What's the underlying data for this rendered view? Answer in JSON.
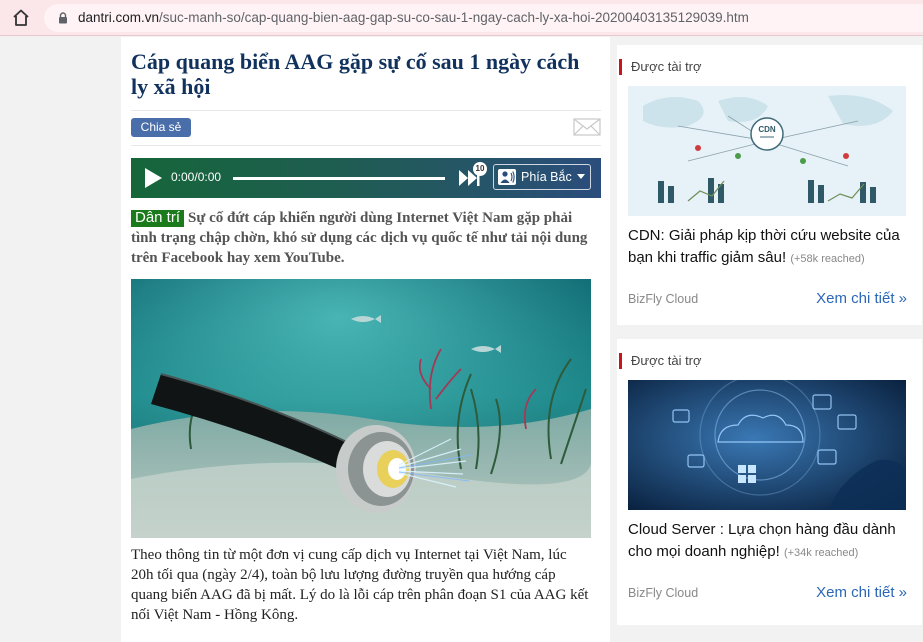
{
  "browser": {
    "url_host": "dantri.com.vn",
    "url_path": "/suc-manh-so/cap-quang-bien-aag-gap-su-co-sau-1-ngay-cach-ly-xa-hoi-20200403135129039.htm"
  },
  "article": {
    "title": "Cáp quang biển AAG gặp sự cố sau 1 ngày cách ly xã hội",
    "share_label": "Chia sẻ",
    "player": {
      "time": "0:00/0:00",
      "skip_seconds": "10",
      "voice": "Phía Bắc"
    },
    "sapo_brand": "Dân trí",
    "sapo": "Sự cố đứt cáp khiến người dùng Internet Việt Nam gặp phải tình trạng chập chờn, khó sử dụng các dịch vụ quốc tế như tải nội dung trên Facebook hay xem YouTube.",
    "body": "Theo thông tin từ một đơn vị cung cấp dịch vụ Internet tại Việt Nam, lúc 20h tối qua (ngày 2/4), toàn bộ lưu lượng đường truyền qua hướng cáp quang biển AAG đã bị mất. Lý do là lỗi cáp trên phân đoạn S1 của AAG kết nối Việt Nam - Hồng Kông."
  },
  "sidebar": {
    "ads": [
      {
        "label": "Được tài trợ",
        "image_text": "CDN",
        "title": "CDN: Giải pháp kịp thời cứu website của bạn khi traffic giảm sâu!",
        "reach": "(+58k reached)",
        "source": "BizFly Cloud",
        "more": "Xem chi tiết »"
      },
      {
        "label": "Được tài trợ",
        "title": "Cloud Server : Lựa chọn hàng đầu dành cho mọi doanh nghiệp!",
        "reach": "(+34k reached)",
        "source": "BizFly Cloud",
        "more": "Xem chi tiết »"
      }
    ]
  },
  "colors": {
    "title": "#12325e",
    "brand_green": "#1b7a1b",
    "link_blue": "#2b67b7",
    "ad_accent": "#c4161c"
  }
}
